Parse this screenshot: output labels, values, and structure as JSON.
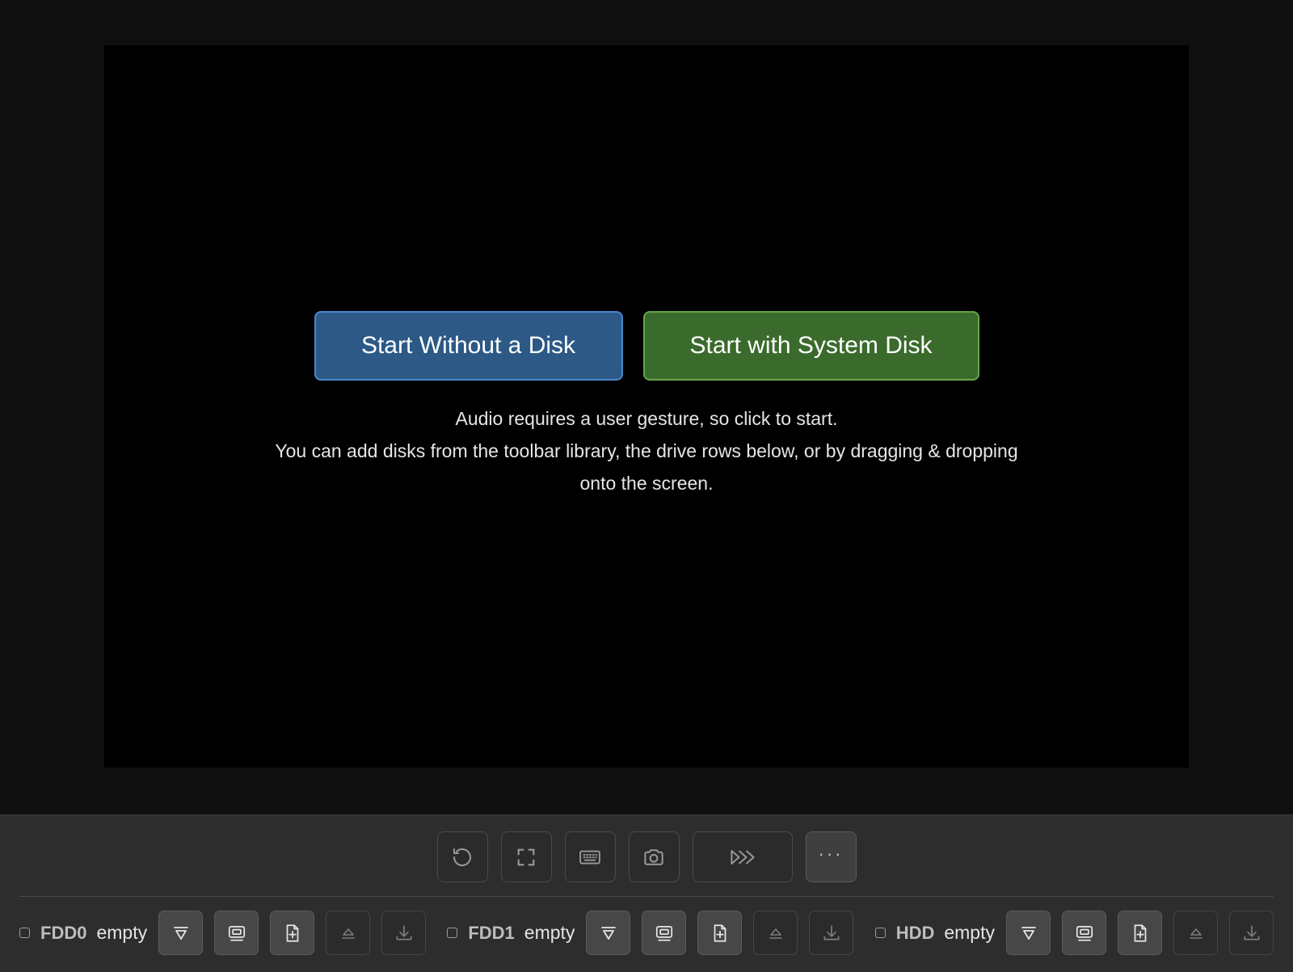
{
  "start": {
    "no_disk_label": "Start Without a Disk",
    "system_disk_label": "Start with System Disk"
  },
  "info": {
    "line1": "Audio requires a user gesture, so click to start.",
    "line2": "You can add disks from the toolbar library, the drive rows below, or by dragging & dropping onto the screen."
  },
  "toolbar": {
    "buttons": [
      {
        "icon": "reset-icon"
      },
      {
        "icon": "fullscreen-icon"
      },
      {
        "icon": "keyboard-icon"
      },
      {
        "icon": "camera-icon"
      },
      {
        "icon": "fast-forward-icon"
      },
      {
        "icon": "more-icon",
        "label": "···"
      }
    ]
  },
  "drives": [
    {
      "name": "FDD0",
      "status": "empty"
    },
    {
      "name": "FDD1",
      "status": "empty"
    },
    {
      "name": "HDD",
      "status": "empty"
    }
  ],
  "drive_buttons": [
    "library-dropdown-icon",
    "disk-image-icon",
    "new-file-icon",
    "eject-icon",
    "download-icon"
  ],
  "colors": {
    "blue_button": "#2c5986",
    "green_button": "#3a6b2c",
    "toolbar_bg": "#2d2d2d"
  }
}
